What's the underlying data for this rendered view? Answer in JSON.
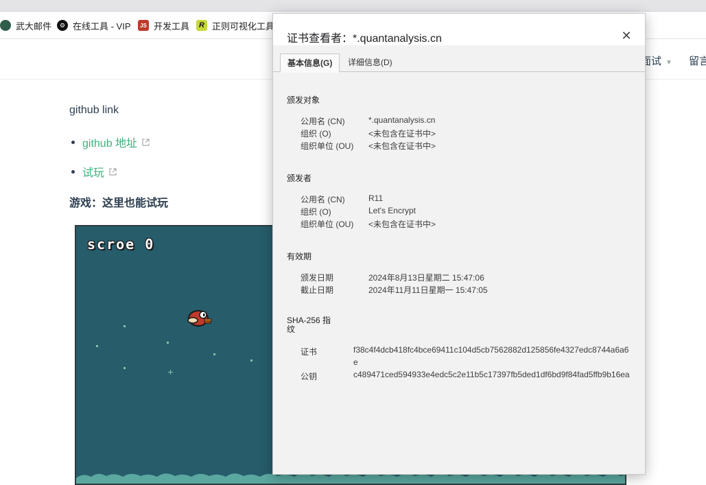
{
  "bookmarks": [
    {
      "label": "武大邮件",
      "icon": "whu-icon"
    },
    {
      "label": "在线工具 - VIP",
      "icon": "gear-icon"
    },
    {
      "label": "开发工具",
      "icon": "js-icon"
    },
    {
      "label": "正则可视化工具",
      "icon": "regex-icon"
    }
  ],
  "nav": {
    "item1": "面试",
    "item2": "留言"
  },
  "content": {
    "heading": "github link",
    "links": [
      "github 地址",
      "试玩"
    ],
    "game_heading": "游戏：这里也能试玩",
    "game_score_label": "scroe",
    "game_score_value": "0"
  },
  "dialog": {
    "title": "证书查看者：*.quantanalysis.cn",
    "close": "✕",
    "tabs": [
      "基本信息(G)",
      "详细信息(D)"
    ],
    "issued_to": {
      "title": "颁发对象",
      "rows": [
        {
          "label": "公用名 (CN)",
          "value": "*.quantanalysis.cn"
        },
        {
          "label": "组织 (O)",
          "value": "<未包含在证书中>"
        },
        {
          "label": "组织单位 (OU)",
          "value": "<未包含在证书中>"
        }
      ]
    },
    "issued_by": {
      "title": "颁发者",
      "rows": [
        {
          "label": "公用名 (CN)",
          "value": "R11"
        },
        {
          "label": "组织 (O)",
          "value": "Let's Encrypt"
        },
        {
          "label": "组织单位 (OU)",
          "value": "<未包含在证书中>"
        }
      ]
    },
    "validity": {
      "title": "有效期",
      "rows": [
        {
          "label": "颁发日期",
          "value": "2024年8月13日星期二 15:47:06"
        },
        {
          "label": "截止日期",
          "value": "2024年11月11日星期一 15:47:05"
        }
      ]
    },
    "fingerprints": {
      "title_line1": "SHA-256 指",
      "title_line2": "纹",
      "rows": [
        {
          "label": "证书",
          "value": "f38c4f4dcb418fc4bce69411c104d5cb7562882d125856fe4327edc8744a6a6e"
        },
        {
          "label": "公钥",
          "value": "c489471ced594933e4edc5c2e11b5c17397fb5ded1df6bd9f84fad5ffb9b16ea"
        }
      ]
    }
  },
  "colors": {
    "link": "#3eaf7c",
    "game_bg": "#275c6b",
    "dialog_bg": "#f2f2f2"
  }
}
